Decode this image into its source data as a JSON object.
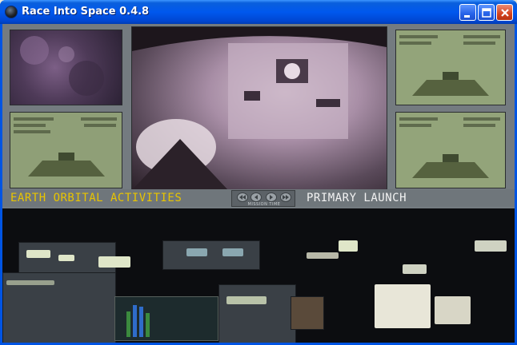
{
  "window": {
    "title": "Race Into Space 0.4.8",
    "icons": {
      "app": "globe-icon",
      "minimize": "minimize-icon",
      "maximize": "maximize-icon",
      "close": "close-icon"
    }
  },
  "game": {
    "mission_name": "EARTH ORBITAL ACTIVITIES",
    "phase": "PRIMARY LAUNCH",
    "mission_time_label": "MISSION TIME",
    "controls": [
      "rewind-icon",
      "step-back-icon",
      "play-icon",
      "fast-forward-icon"
    ]
  },
  "colors": {
    "accent_yellow": "#e8c400",
    "frame_gray": "#747b80",
    "titlebar_blue": "#0058ee"
  }
}
